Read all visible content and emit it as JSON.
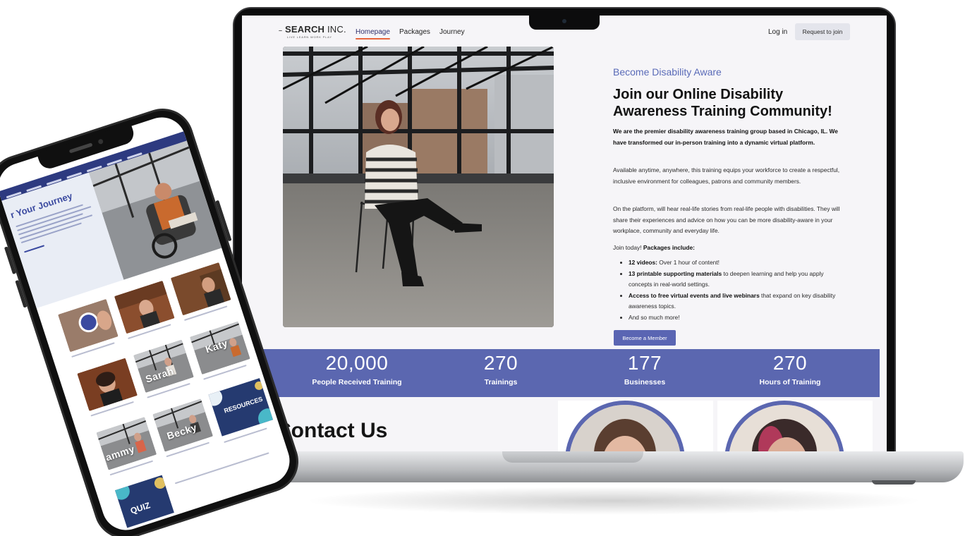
{
  "laptop": {
    "logo": {
      "brand": "SEARCH",
      "suffix": "INC.",
      "tagline": "LIVE LEARN WORK PLAY"
    },
    "nav": {
      "homepage": "Homepage",
      "packages": "Packages",
      "journey": "Journey",
      "login": "Log in",
      "request": "Request to join"
    },
    "hero": {
      "kicker": "Become Disability Aware",
      "headline": "Join our Online Disability Awareness Training Community!",
      "intro": "We are the premier disability awareness training group based in Chicago, IL. We have transformed our in-person training into a dynamic virtual platform.",
      "para2": "Available anytime, anywhere, this training equips your workforce to create a respectful, inclusive environment for colleagues, patrons and community members.",
      "para3": "On the platform, will hear real-life stories from real-life people with disabilities. They will share their experiences and advice on how you can be more disability-aware in your workplace, community and everyday life.",
      "join_prefix": "Join today!",
      "join_bold": "Packages include:",
      "bullets": [
        {
          "bold": "12 videos:",
          "rest": " Over 1 hour of content!"
        },
        {
          "bold": "13 printable supporting materials",
          "rest": " to deepen learning and help you apply concepts in real-world settings."
        },
        {
          "bold": "Access to free virtual events and live webinars",
          "rest": " that expand on key disability awareness topics."
        },
        {
          "bold": "",
          "rest": "And so much more!"
        }
      ],
      "cta": "Become a Member"
    },
    "stats": [
      {
        "value": "20,000",
        "label": "People Received Training"
      },
      {
        "value": "270",
        "label": "Trainings"
      },
      {
        "value": "177",
        "label": "Businesses"
      },
      {
        "value": "270",
        "label": "Hours of Training"
      }
    ],
    "contact": "Contact Us"
  },
  "phone": {
    "journey_title": "r Your Journey",
    "tile_names": [
      "Sarah",
      "Katy",
      "Becky",
      "ammy"
    ],
    "resources": "RESOURCES",
    "quiz": "QUIZ"
  },
  "colors": {
    "accent": "#5b67b0",
    "nav_underline": "#e8643c",
    "phone_nav": "#2d3a80"
  }
}
